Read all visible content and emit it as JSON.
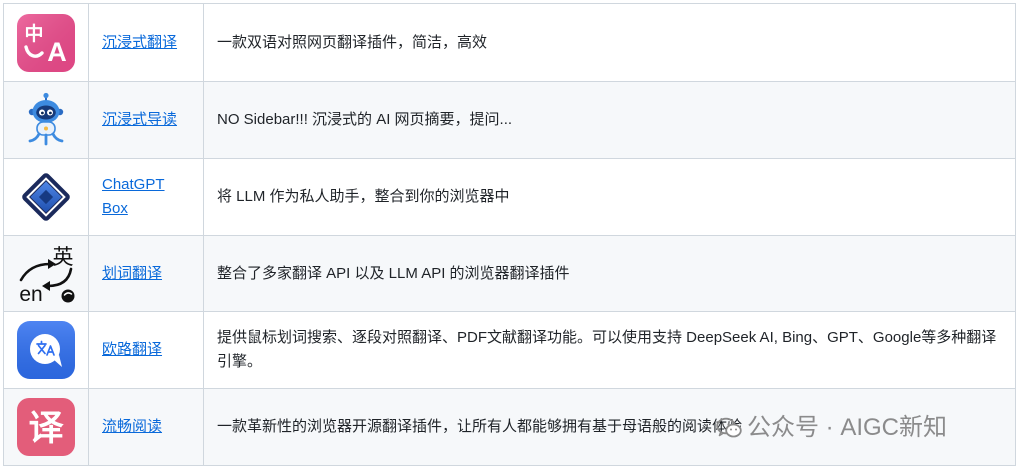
{
  "colors": {
    "link": "#0969da",
    "text": "#1f2328",
    "border": "#d0d7de",
    "row_alt_bg": "#f6f8fa"
  },
  "rows": [
    {
      "icon": "immersive-translate-icon",
      "icon_color": "#eb4a8b",
      "logo_text": [
        "中",
        "A"
      ],
      "name": "沉浸式翻译",
      "description": "一款双语对照网页翻译插件，简洁，高效"
    },
    {
      "icon": "robot-mascot-icon",
      "icon_color": "#3d8be0",
      "name": "沉浸式导读",
      "description": "NO Sidebar!!! 沉浸式的 AI 网页摘要，提问..."
    },
    {
      "icon": "diamond-box-icon",
      "icon_color": "#1b2a5c",
      "name": "ChatGPT Box",
      "description": "将 LLM 作为私人助手，整合到你的浏览器中"
    },
    {
      "icon": "word-translate-icon",
      "icon_color": "#111111",
      "logo_text": [
        "英",
        "en"
      ],
      "name": "划词翻译",
      "description": "整合了多家翻译 API 以及 LLM API 的浏览器翻译插件"
    },
    {
      "icon": "translate-bubble-icon",
      "icon_color": "#2f6ff0",
      "name": "欧路翻译",
      "description": "提供鼠标划词搜索、逐段对照翻译、PDF文献翻译功能。可以使用支持 DeepSeek AI, Bing、GPT、Google等多种翻译引擎。"
    },
    {
      "icon": "fluent-read-icon",
      "icon_color": "#e35d7a",
      "logo_text": [
        "译"
      ],
      "name": "流畅阅读",
      "description": "一款革新性的浏览器开源翻译插件，让所有人都能够拥有基于母语般的阅读体验"
    }
  ],
  "watermark": {
    "icon": "wechat-icon",
    "text": "公众号 · AIGC新知"
  }
}
